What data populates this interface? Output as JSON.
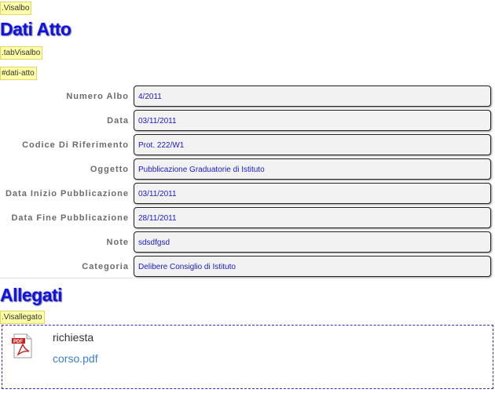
{
  "tags": {
    "visalbo": ".Visalbo",
    "tab_visalbo": ".tabVisalbo",
    "dati_atto": "#dati-atto",
    "visallegato": ".Visallegato"
  },
  "headings": {
    "dati_atto": "Dati Atto",
    "allegati": "Allegati"
  },
  "fields": [
    {
      "label": "Numero Albo",
      "value": "4/2011"
    },
    {
      "label": "Data",
      "value": "03/11/2011"
    },
    {
      "label": "Codice Di Riferimento",
      "value": "Prot. 222/W1"
    },
    {
      "label": "Oggetto",
      "value": "Pubblicazione Graduatorie di Istituto"
    },
    {
      "label": "Data Inizio Pubblicazione",
      "value": "03/11/2011"
    },
    {
      "label": "Data Fine Pubblicazione",
      "value": "28/11/2011"
    },
    {
      "label": "Note",
      "value": "sdsdfgsd"
    },
    {
      "label": "Categoria",
      "value": "Delibere Consiglio di Istituto"
    }
  ],
  "attachment": {
    "title": "richiesta",
    "file_link": "corso.pdf",
    "icon": "pdf-file-icon"
  },
  "colors": {
    "heading": "#1010e8",
    "value_text": "#1a1acc",
    "link": "#3a7fc8",
    "tag_bg": "#ffffa8"
  }
}
